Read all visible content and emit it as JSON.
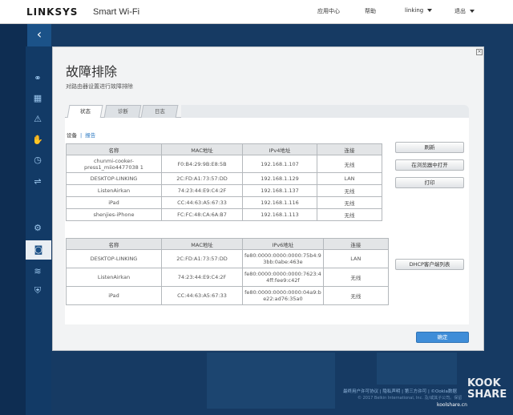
{
  "header": {
    "logo": "LINKSYS",
    "logo_sub": "Smart Wi-Fi",
    "app_center": "应用中心",
    "help": "帮助",
    "user": "linking",
    "logout": "退出"
  },
  "sidebar": {
    "back": "‹",
    "icons": [
      "network-map-icon",
      "device-list-icon",
      "alert-icon",
      "parental-controls-icon",
      "speed-test-icon",
      "usb-storage-icon",
      "settings-icon",
      "troubleshooting-icon",
      "wifi-icon",
      "security-icon"
    ]
  },
  "modal": {
    "title": "故障排除",
    "subtitle": "对路由器设置进行故障排除",
    "close": "×",
    "tabs": [
      {
        "label": "状态",
        "active": true
      },
      {
        "label": "诊断",
        "active": false
      },
      {
        "label": "日志",
        "active": false
      }
    ],
    "subnav": {
      "devices": "设备",
      "sep": "|",
      "report": "报告"
    },
    "ipv4_table": {
      "headers": [
        "名称",
        "MAC地址",
        "IPv4地址",
        "连接"
      ],
      "rows": [
        [
          "chunmi-cooker-press1_miio4477038 1",
          "F0:B4:29:9B:E8:5B",
          "192.168.1.107",
          "无线"
        ],
        [
          "DESKTOP-LINKING",
          "2C:FD:A1:73:57:DD",
          "192.168.1.129",
          "LAN"
        ],
        [
          "ListenAirkan",
          "74:23:44:E9:C4:2F",
          "192.168.1.137",
          "无线"
        ],
        [
          "iPad",
          "CC:44:63:A5:67:33",
          "192.168.1.116",
          "无线"
        ],
        [
          "shenjies-iPhone",
          "FC:FC:48:CA:6A:B7",
          "192.168.1.113",
          "无线"
        ]
      ]
    },
    "ipv6_table": {
      "headers": [
        "名称",
        "MAC地址",
        "IPv6地址",
        "连接"
      ],
      "rows": [
        [
          "DESKTOP-LINKING",
          "2C:FD:A1:73:57:DD",
          "fe80:0000:0000:0000:75b4:9 3bb:0abe:463e",
          "LAN"
        ],
        [
          "ListenAirkan",
          "74:23:44:E9:C4:2F",
          "fe80:0000:0000:0000:7623:4 4ff:fee9:c42f",
          "无线"
        ],
        [
          "iPad",
          "CC:44:63:A5:67:33",
          "fe80:0000:0000:0000:04a9:b e22:ad76:35a0",
          "无线"
        ]
      ]
    },
    "buttons": {
      "refresh": "刷新",
      "open_browser": "在浏览器中打开",
      "print": "打印",
      "dhcp": "DHCP客户端列表",
      "ok": "确定"
    }
  },
  "footer": {
    "links": "最终用户许可协议 | 隐私声明 | 第三方许可 | ©Ookla数据",
    "copyright": "© 2017 Belkin International, Inc. 及/或其子公司。保留",
    "watermark": "KOOK SHARE",
    "watermark_site": "koolshare.cn"
  }
}
